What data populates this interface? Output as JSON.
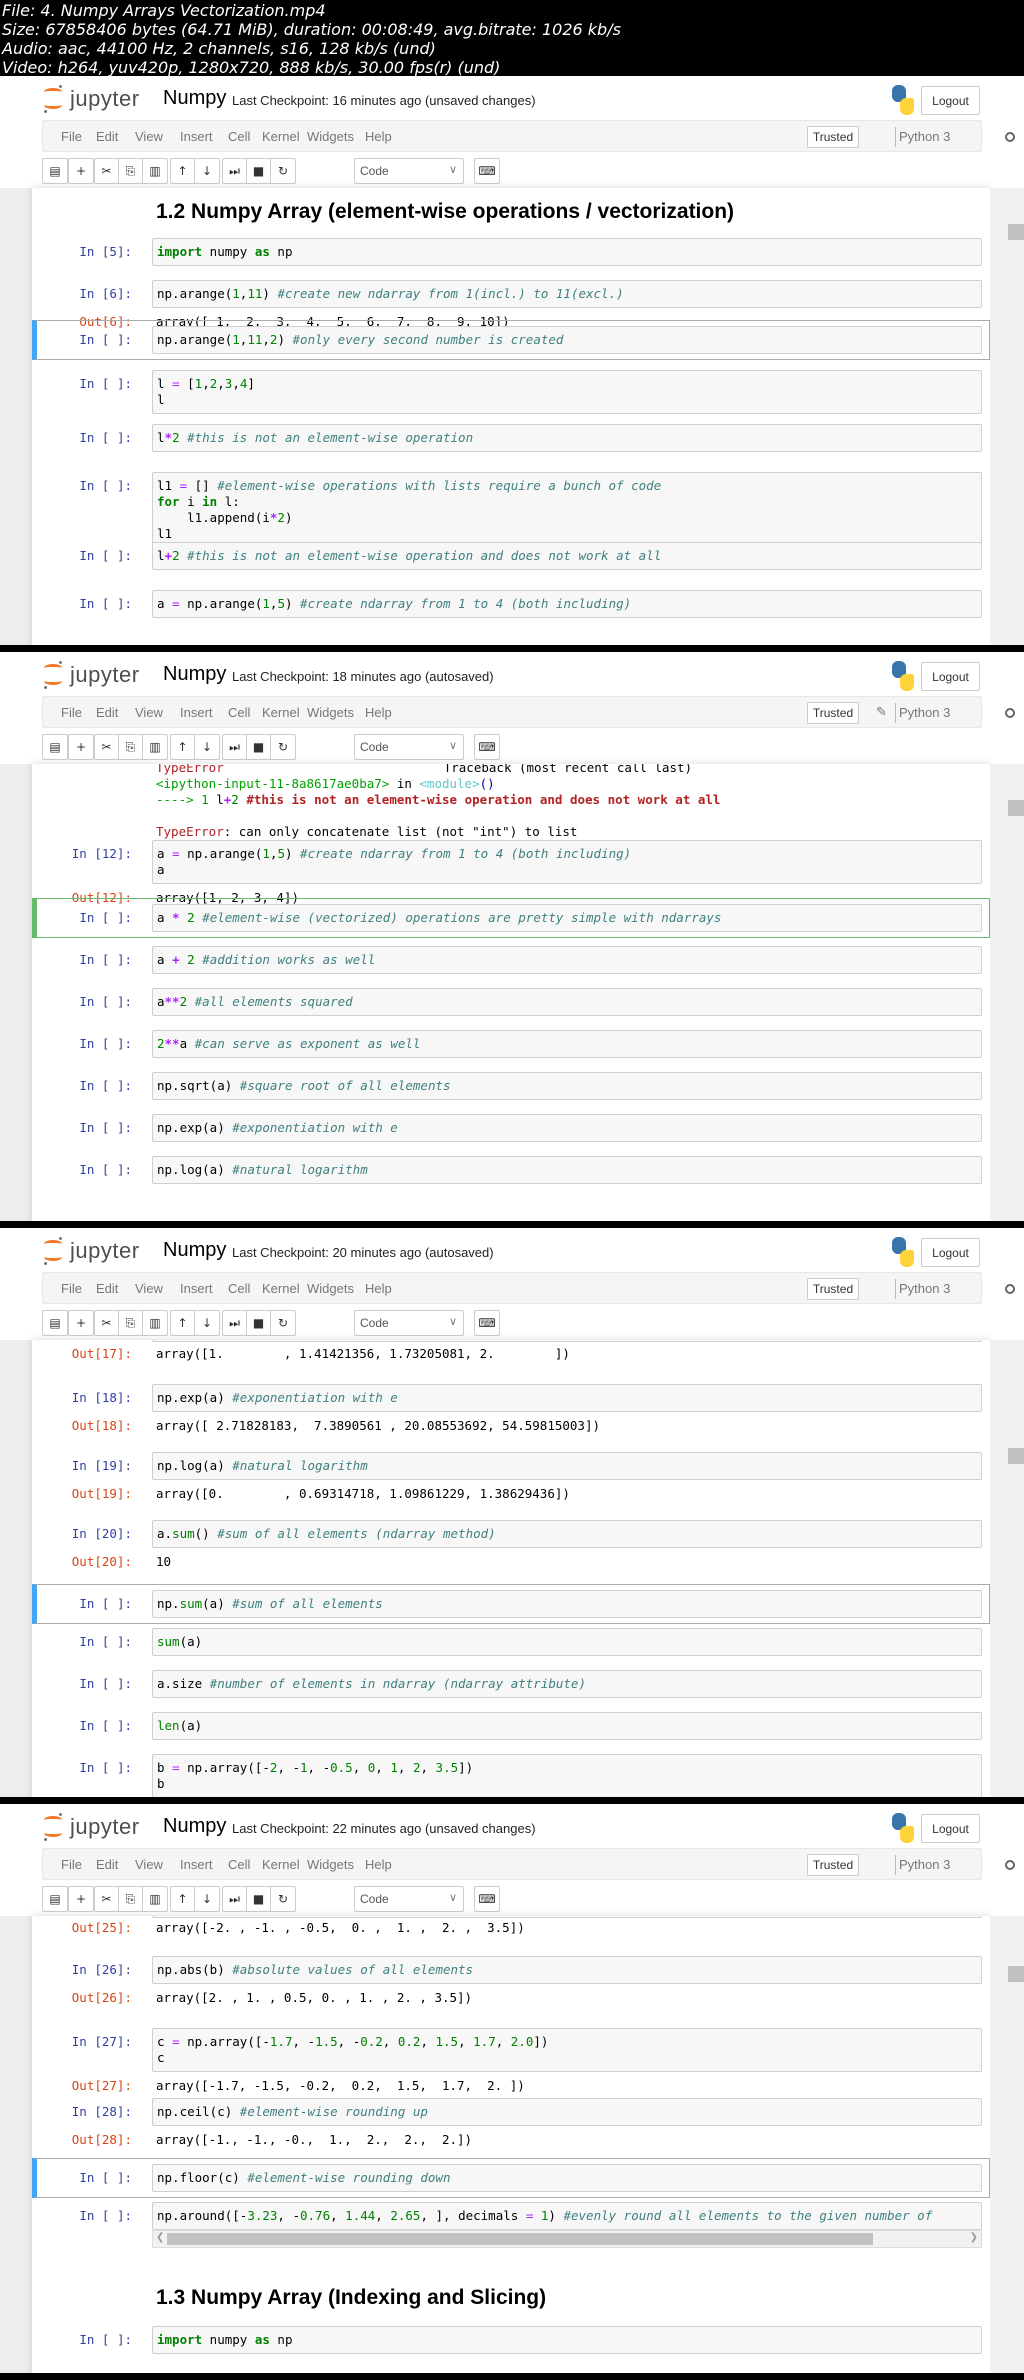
{
  "file_info": {
    "line1": "File: 4. Numpy Arrays Vectorization.mp4",
    "line2": "Size: 67858406 bytes (64.71 MiB), duration: 00:08:49, avg.bitrate: 1026 kb/s",
    "line3": "Audio: aac, 44100 Hz, 2 channels, s16, 128 kb/s (und)",
    "line4": "Video: h264, yuv420p, 1280x720, 888 kb/s, 30.00 fps(r) (und)"
  },
  "app": {
    "logo_text": "jupyter",
    "notebook_name": "Numpy",
    "logout_label": "Logout",
    "trusted_label": "Trusted",
    "kernel_name": "Python 3",
    "celltype_value": "Code",
    "menu": [
      "File",
      "Edit",
      "View",
      "Insert",
      "Cell",
      "Kernel",
      "Widgets",
      "Help"
    ],
    "toolbar_icons": [
      "save-icon",
      "plus-icon",
      "cut-icon",
      "copy-icon",
      "paste-icon",
      "arrow-up-icon",
      "arrow-down-icon",
      "step-forward-icon",
      "stop-icon",
      "restart-icon",
      "keyboard-icon"
    ]
  },
  "frames": [
    {
      "checkpoint": "Last Checkpoint: 16 minutes ago (unsaved changes)",
      "heading": "1.2 Numpy Array (element-wise operations / vectorization)",
      "cells": [
        {
          "prompt": "In [5]:",
          "code": "import numpy as np"
        },
        {
          "prompt": "In [6]:",
          "code": "np.arange(1,11) #create new ndarray from 1(incl.) to 11(excl.)",
          "out_prompt": "Out[6]:",
          "output": "array([ 1,  2,  3,  4,  5,  6,  7,  8,  9, 10])"
        },
        {
          "prompt": "In [ ]:",
          "code": "np.arange(1,11,2) #only every second number is created"
        },
        {
          "prompt": "In [ ]:",
          "code": "l = [1,2,3,4]\nl"
        },
        {
          "prompt": "In [ ]:",
          "code": "l*2 #this is not an element-wise operation"
        },
        {
          "prompt": "In [ ]:",
          "code": "l1 = [] #element-wise operations with lists require a bunch of code\nfor i in l:\n    l1.append(i*2)\nl1"
        },
        {
          "prompt": "In [ ]:",
          "code": "l+2 #this is not an element-wise operation and does not work at all"
        },
        {
          "prompt": "In [ ]:",
          "code": "a = np.arange(1,5) #create ndarray from 1 to 4 (both including)"
        }
      ]
    },
    {
      "checkpoint": "Last Checkpoint: 18 minutes ago (autosaved)",
      "traceback": {
        "header_left": "TypeError",
        "header_right": "Traceback (most recent call last)",
        "source": "<ipython-input-11-8a8617ae0ba7>",
        "in_text": " in ",
        "module": "<module>",
        "parens": "()",
        "arrow": "----> 1 ",
        "line_code_l": "l",
        "line_code_plus": "+",
        "line_code_2": "2",
        "line_comment": " #this is not an element-wise operation and does not work at all",
        "error_type": "TypeError",
        "error_msg": ": can only concatenate list (not \"int\") to list"
      },
      "cells": [
        {
          "prompt": "In [12]:",
          "code": "a = np.arange(1,5) #create ndarray from 1 to 4 (both including)\na",
          "out_prompt": "Out[12]:",
          "output": "array([1, 2, 3, 4])"
        },
        {
          "prompt": "In [ ]:",
          "code": "a * 2 #element-wise (vectorized) operations are pretty simple with ndarrays"
        },
        {
          "prompt": "In [ ]:",
          "code": "a + 2 #addition works as well"
        },
        {
          "prompt": "In [ ]:",
          "code": "a**2 #all elements squared"
        },
        {
          "prompt": "In [ ]:",
          "code": "2**a #can serve as exponent as well"
        },
        {
          "prompt": "In [ ]:",
          "code": "np.sqrt(a) #square root of all elements"
        },
        {
          "prompt": "In [ ]:",
          "code": "np.exp(a) #exponentiation with e"
        },
        {
          "prompt": "In [ ]:",
          "code": "np.log(a) #natural logarithm"
        }
      ]
    },
    {
      "checkpoint": "Last Checkpoint: 20 minutes ago (autosaved)",
      "cells": [
        {
          "out_prompt": "Out[17]:",
          "output": "array([1.        , 1.41421356, 1.73205081, 2.        ])"
        },
        {
          "prompt": "In [18]:",
          "code": "np.exp(a) #exponentiation with e",
          "out_prompt": "Out[18]:",
          "output": "array([ 2.71828183,  7.3890561 , 20.08553692, 54.59815003])"
        },
        {
          "prompt": "In [19]:",
          "code": "np.log(a) #natural logarithm",
          "out_prompt": "Out[19]:",
          "output": "array([0.        , 0.69314718, 1.09861229, 1.38629436])"
        },
        {
          "prompt": "In [20]:",
          "code": "a.sum() #sum of all elements (ndarray method)",
          "out_prompt": "Out[20]:",
          "output": "10"
        },
        {
          "prompt": "In [ ]:",
          "code": "np.sum(a) #sum of all elements"
        },
        {
          "prompt": "In [ ]:",
          "code": "sum(a)"
        },
        {
          "prompt": "In [ ]:",
          "code": "a.size #number of elements in ndarray (ndarray attribute)"
        },
        {
          "prompt": "In [ ]:",
          "code": "len(a)"
        },
        {
          "prompt": "In [ ]:",
          "code": "b = np.array([-2, -1, -0.5, 0, 1, 2, 3.5])\nb"
        }
      ]
    },
    {
      "checkpoint": "Last Checkpoint: 22 minutes ago (unsaved changes)",
      "heading": "1.3 Numpy Array (Indexing and Slicing)",
      "cells": [
        {
          "out_prompt": "Out[25]:",
          "output": "array([-2. , -1. , -0.5,  0. ,  1. ,  2. ,  3.5])"
        },
        {
          "prompt": "In [26]:",
          "code": "np.abs(b) #absolute values of all elements",
          "out_prompt": "Out[26]:",
          "output": "array([2. , 1. , 0.5, 0. , 1. , 2. , 3.5])"
        },
        {
          "prompt": "In [27]:",
          "code": "c = np.array([-1.7, -1.5, -0.2, 0.2, 1.5, 1.7, 2.0])\nc",
          "out_prompt": "Out[27]:",
          "output": "array([-1.7, -1.5, -0.2,  0.2,  1.5,  1.7,  2. ])"
        },
        {
          "prompt": "In [28]:",
          "code": "np.ceil(c) #element-wise rounding up",
          "out_prompt": "Out[28]:",
          "output": "array([-1., -1., -0.,  1.,  2.,  2.,  2.])"
        },
        {
          "prompt": "In [ ]:",
          "code": "np.floor(c) #element-wise rounding down"
        },
        {
          "prompt": "In [ ]:",
          "code": "np.around([-3.23, -0.76, 1.44, 2.65, ], decimals = 1) #evenly round all elements to the given number of"
        },
        {
          "prompt": "In [ ]:",
          "code": "import numpy as np"
        }
      ]
    }
  ]
}
